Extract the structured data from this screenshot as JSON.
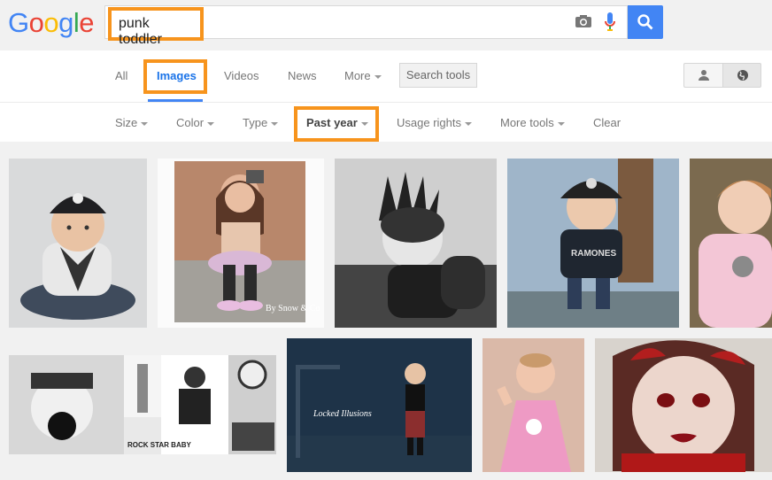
{
  "search": {
    "query": "punk toddler"
  },
  "logo": {
    "letters": [
      "G",
      "o",
      "o",
      "g",
      "l",
      "e"
    ],
    "colors": [
      "#4285f4",
      "#ea4335",
      "#fbbc05",
      "#4285f4",
      "#34a853",
      "#ea4335"
    ]
  },
  "tabs": [
    {
      "label": "All"
    },
    {
      "label": "Images"
    },
    {
      "label": "Videos"
    },
    {
      "label": "News"
    },
    {
      "label": "More"
    }
  ],
  "toolbar": {
    "search_tools": "Search tools"
  },
  "filters": [
    {
      "label": "Size"
    },
    {
      "label": "Color"
    },
    {
      "label": "Type"
    },
    {
      "label": "Past year"
    },
    {
      "label": "Usage rights"
    },
    {
      "label": "More tools"
    },
    {
      "label": "Clear"
    }
  ],
  "results": {
    "row2": {
      "rockstar_caption": "ROCK STAR BABY",
      "lockedillusions_caption": "Locked Illusions",
      "snow_caption": "By Snow & Co"
    }
  },
  "colors": {
    "accent": "#4285f4",
    "highlight": "#f7941d"
  }
}
